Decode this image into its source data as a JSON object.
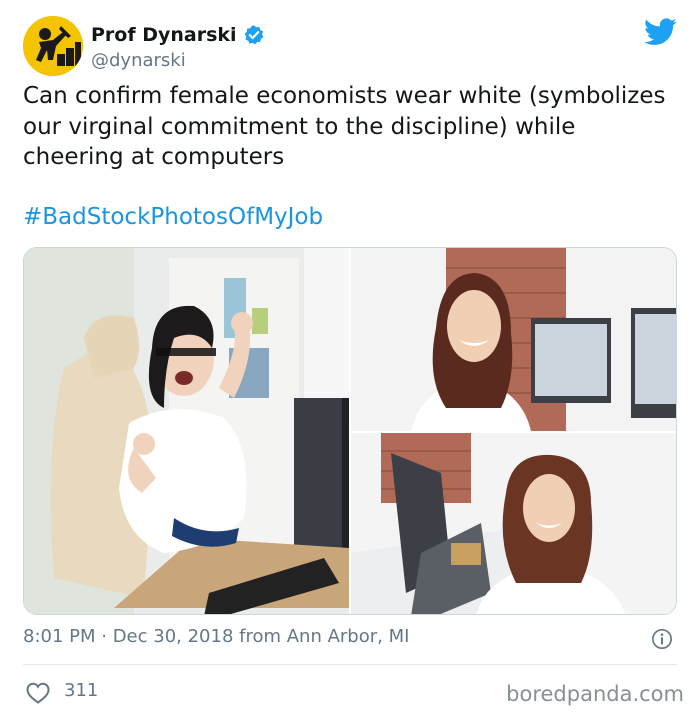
{
  "author": {
    "display_name": "Prof Dynarski",
    "handle": "@dynarski",
    "verified": true,
    "avatar": "avatar-construction-worker-icon"
  },
  "tweet": {
    "text": "Can confirm female economists wear white (symbolizes our virginal commitment to the discipline) while cheering at computers",
    "hashtag": "#BadStockPhotosOfMyJob"
  },
  "media": {
    "photos": [
      "woman-with-glasses-cheering-at-computer",
      "woman-in-white-smiling-near-monitors",
      "woman-in-white-smiling-at-desk"
    ]
  },
  "meta": {
    "timestamp": "8:01 PM · Dec 30, 2018 from Ann Arbor, MI"
  },
  "engagement": {
    "likes": "311"
  },
  "watermark": "boredpanda.com",
  "colors": {
    "link": "#1b95e0",
    "secondary_text": "#657786",
    "avatar_bg": "#f5c400",
    "twitter_blue": "#1da1f2"
  }
}
